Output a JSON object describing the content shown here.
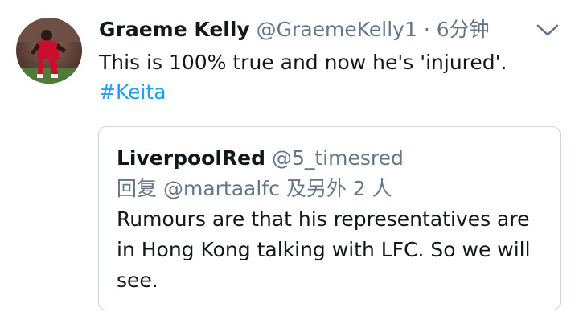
{
  "tweet": {
    "author_name": "Graeme Kelly",
    "author_handle": "@GraemeKelly1",
    "separator": "·",
    "timestamp": "6分钟",
    "text": "This is 100% true and now he's 'injured'.",
    "hashtag": "#Keita",
    "menu_icon": "chevron-down-icon",
    "avatar_icon": "profile-avatar"
  },
  "quote": {
    "author_name": "LiverpoolRed",
    "author_handle": "@5_timesred",
    "reply_prefix": "回复",
    "reply_mention": "@martaalfc",
    "reply_suffix": "及另外 2 人",
    "text": "Rumours are that his representatives are in Hong Kong talking with LFC. So we will see."
  },
  "colors": {
    "link": "#1da1f2",
    "muted": "#657786",
    "text": "#14171a",
    "border": "#ccd6dd"
  }
}
